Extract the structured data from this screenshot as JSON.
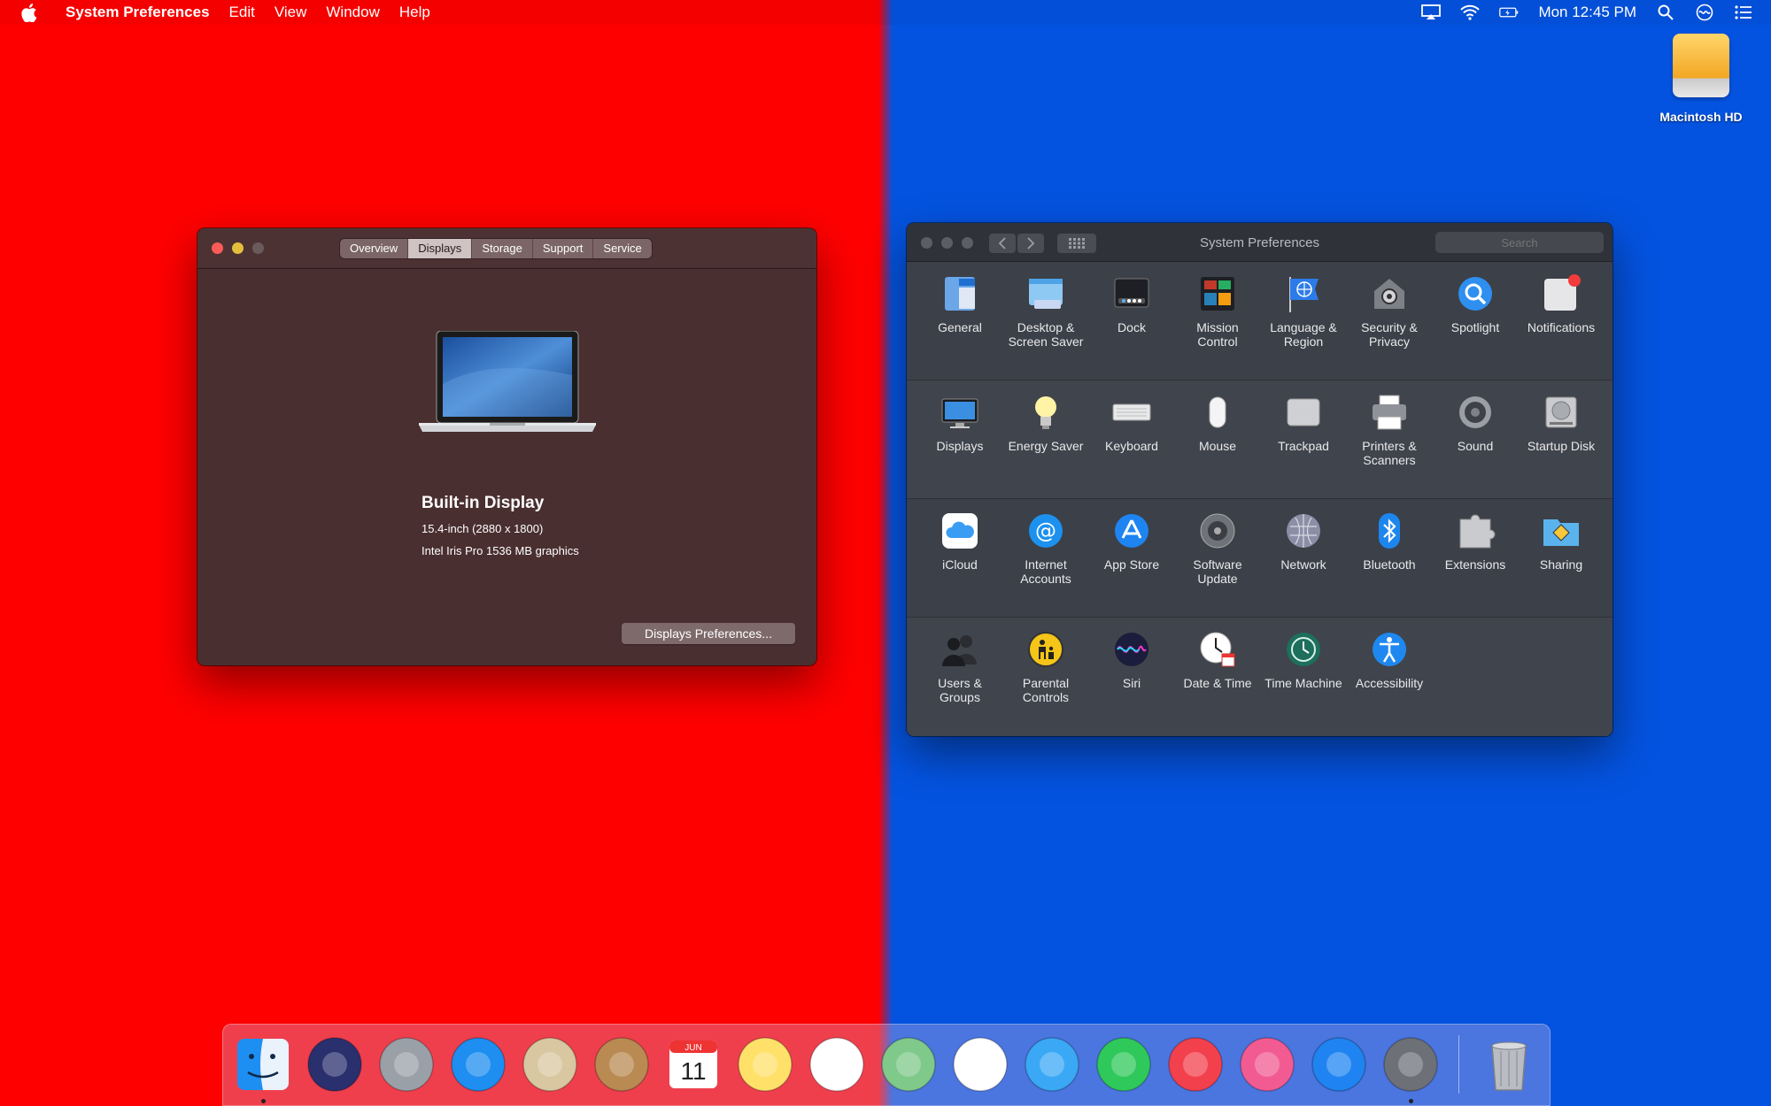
{
  "menubar": {
    "app_name": "System Preferences",
    "items": [
      "Edit",
      "View",
      "Window",
      "Help"
    ],
    "clock": "Mon 12:45 PM"
  },
  "desktop": {
    "drive_label": "Macintosh HD"
  },
  "about_window": {
    "tabs": [
      "Overview",
      "Displays",
      "Storage",
      "Support",
      "Service"
    ],
    "active_tab": "Displays",
    "display_title": "Built-in Display",
    "display_size": "15.4-inch (2880 x 1800)",
    "graphics": "Intel Iris Pro 1536 MB graphics",
    "button_label": "Displays Preferences..."
  },
  "sysprefs": {
    "title": "System Preferences",
    "search_placeholder": "Search",
    "rows": [
      [
        {
          "label": "General",
          "icon": "general-icon"
        },
        {
          "label": "Desktop & Screen Saver",
          "icon": "desktop-screensaver-icon"
        },
        {
          "label": "Dock",
          "icon": "dock-icon"
        },
        {
          "label": "Mission Control",
          "icon": "mission-control-icon"
        },
        {
          "label": "Language & Region",
          "icon": "language-region-icon"
        },
        {
          "label": "Security & Privacy",
          "icon": "security-privacy-icon"
        },
        {
          "label": "Spotlight",
          "icon": "spotlight-icon"
        },
        {
          "label": "Notifications",
          "icon": "notifications-icon"
        }
      ],
      [
        {
          "label": "Displays",
          "icon": "displays-icon"
        },
        {
          "label": "Energy Saver",
          "icon": "energy-saver-icon"
        },
        {
          "label": "Keyboard",
          "icon": "keyboard-icon"
        },
        {
          "label": "Mouse",
          "icon": "mouse-icon"
        },
        {
          "label": "Trackpad",
          "icon": "trackpad-icon"
        },
        {
          "label": "Printers & Scanners",
          "icon": "printers-scanners-icon"
        },
        {
          "label": "Sound",
          "icon": "sound-icon"
        },
        {
          "label": "Startup Disk",
          "icon": "startup-disk-icon"
        }
      ],
      [
        {
          "label": "iCloud",
          "icon": "icloud-icon"
        },
        {
          "label": "Internet Accounts",
          "icon": "internet-accounts-icon"
        },
        {
          "label": "App Store",
          "icon": "app-store-icon"
        },
        {
          "label": "Software Update",
          "icon": "software-update-icon"
        },
        {
          "label": "Network",
          "icon": "network-icon"
        },
        {
          "label": "Bluetooth",
          "icon": "bluetooth-icon"
        },
        {
          "label": "Extensions",
          "icon": "extensions-icon"
        },
        {
          "label": "Sharing",
          "icon": "sharing-icon"
        }
      ],
      [
        {
          "label": "Users & Groups",
          "icon": "users-groups-icon"
        },
        {
          "label": "Parental Controls",
          "icon": "parental-controls-icon"
        },
        {
          "label": "Siri",
          "icon": "siri-icon"
        },
        {
          "label": "Date & Time",
          "icon": "date-time-icon"
        },
        {
          "label": "Time Machine",
          "icon": "time-machine-icon"
        },
        {
          "label": "Accessibility",
          "icon": "accessibility-icon"
        }
      ]
    ]
  },
  "dock": {
    "apps": [
      {
        "name": "finder",
        "color": "#2b9af3",
        "running": true
      },
      {
        "name": "siri",
        "color": "#2a2f6e",
        "running": false
      },
      {
        "name": "launchpad",
        "color": "#9aa0a8",
        "running": false
      },
      {
        "name": "safari",
        "color": "#1e8ef0",
        "running": false
      },
      {
        "name": "mail",
        "color": "#d8c7a0",
        "running": false
      },
      {
        "name": "contacts",
        "color": "#b98a52",
        "running": false
      },
      {
        "name": "calendar",
        "color": "#ffffff",
        "running": false
      },
      {
        "name": "notes",
        "color": "#ffe16a",
        "running": false
      },
      {
        "name": "reminders",
        "color": "#ffffff",
        "running": false
      },
      {
        "name": "maps",
        "color": "#7fc98a",
        "running": false
      },
      {
        "name": "photos",
        "color": "#ffffff",
        "running": false
      },
      {
        "name": "messages",
        "color": "#3aa8f5",
        "running": false
      },
      {
        "name": "facetime",
        "color": "#2ec95a",
        "running": false
      },
      {
        "name": "news",
        "color": "#f3404d",
        "running": false
      },
      {
        "name": "itunes",
        "color": "#f25b92",
        "running": false
      },
      {
        "name": "app-store",
        "color": "#1f84f2",
        "running": false
      },
      {
        "name": "system-preferences",
        "color": "#6d7077",
        "running": true
      }
    ],
    "calendar_month": "JUN",
    "calendar_day": "11"
  }
}
